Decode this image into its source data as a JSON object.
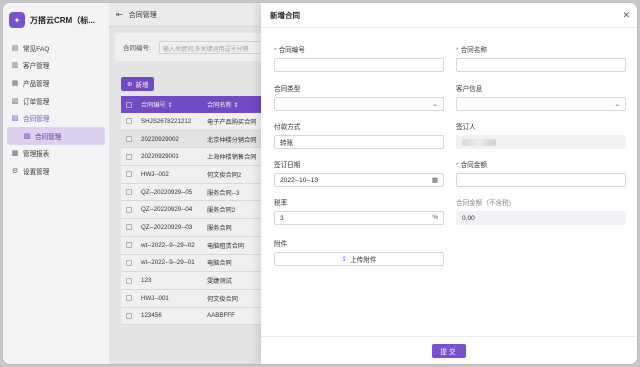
{
  "app": {
    "logo_glyph": "✦",
    "name": "万搭云CRM（标..."
  },
  "sidebar": {
    "items": [
      {
        "label": "常见FAQ",
        "icon": "faq-icon",
        "glyph": "▤"
      },
      {
        "label": "客户管理",
        "icon": "customer-icon",
        "glyph": "▥"
      },
      {
        "label": "产品管理",
        "icon": "product-icon",
        "glyph": "▦"
      },
      {
        "label": "订单管理",
        "icon": "order-icon",
        "glyph": "▧"
      },
      {
        "label": "合同管理",
        "icon": "contract-icon",
        "glyph": "▨"
      },
      {
        "label": "合同管理",
        "icon": "contract-sub-icon",
        "glyph": "▨"
      },
      {
        "label": "管理报表",
        "icon": "report-icon",
        "glyph": "▩"
      },
      {
        "label": "设置管理",
        "icon": "settings-icon",
        "glyph": "⚙"
      }
    ]
  },
  "topbar": {
    "title": "合同管理",
    "menu_glyph": "⇤"
  },
  "search": {
    "label": "合同编号:",
    "placeholder": "输入关键词,多关键词用逗号分隔"
  },
  "new_button": {
    "glyph": "⊕",
    "label": "新增"
  },
  "table": {
    "headers": [
      "合同编号 ⇕",
      "合同名称 ⇕"
    ],
    "rows": [
      [
        "SHJS2678221212",
        "电子产品购买合同"
      ],
      [
        "20220929002",
        "北京仲楼分销合同"
      ],
      [
        "20220929001",
        "上海仲楼销售合同"
      ],
      [
        "HWJ--002",
        "何文俊合同2"
      ],
      [
        "QZ--20220929--05",
        "服务合同--3"
      ],
      [
        "QZ--20220929--04",
        "服务合同2"
      ],
      [
        "QZ--20220929--03",
        "服务合同"
      ],
      [
        "wt--2022--9--29--02",
        "电脑租赁合同"
      ],
      [
        "wt--2022--9--29--01",
        "电脑合同"
      ],
      [
        "123",
        "雯婕测试"
      ],
      [
        "HWJ--001",
        "何文俊合同"
      ],
      [
        "123456",
        "AABBFFF"
      ]
    ]
  },
  "drawer": {
    "title": "新增合同",
    "close_glyph": "✕",
    "fields": {
      "contract_no": {
        "label": "合同编号",
        "value": ""
      },
      "contract_name": {
        "label": "合同名称",
        "value": ""
      },
      "contract_type": {
        "label": "合同类型",
        "value": ""
      },
      "customer_info": {
        "label": "客户信息",
        "value": ""
      },
      "payment": {
        "label": "付款方式",
        "value": "转账"
      },
      "signer": {
        "label": "签订人"
      },
      "sign_date": {
        "label": "签订日期",
        "value": "2022--10--13"
      },
      "amount": {
        "label": "合同金额",
        "value": ""
      },
      "tax_rate": {
        "label": "税率",
        "value": "3",
        "suffix": "%"
      },
      "amount_ex_tax": {
        "label": "合同金额（不含税)",
        "value": "0.00"
      },
      "attachment": {
        "label": "附件",
        "button": "上传附件"
      }
    },
    "submit": "提交"
  }
}
